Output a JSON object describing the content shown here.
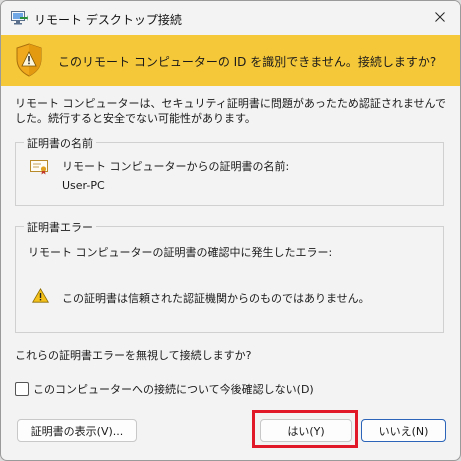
{
  "window": {
    "title": "リモート デスクトップ接続"
  },
  "banner": {
    "text": "このリモート コンピューターの ID を識別できません。接続しますか?"
  },
  "description": "リモート コンピューターは、セキュリティ証明書に問題があったため認証されませんでした。続行すると安全でない可能性があります。",
  "cert_name_group": {
    "label": "証明書の名前",
    "name_label": "リモート コンピューターからの証明書の名前:",
    "name_value": "User-PC"
  },
  "cert_error_group": {
    "label": "証明書エラー",
    "title": "リモート コンピューターの証明書の確認中に発生したエラー:",
    "message": "この証明書は信頼された認証機関からのものではありません。"
  },
  "question": "これらの証明書エラーを無視して接続しますか?",
  "checkbox": {
    "label": "このコンピューターへの接続について今後確認しない(D)",
    "checked": false
  },
  "buttons": {
    "view_cert": "証明書の表示(V)...",
    "yes": "はい(Y)",
    "no": "いいえ(N)"
  },
  "colors": {
    "banner": "#f5c83a",
    "highlight": "#e01828",
    "focus_border": "#2b64b8"
  },
  "icons": {
    "app": "remote-desktop-icon",
    "close": "close-icon",
    "banner": "warning-shield-icon",
    "cert": "certificate-icon",
    "warning": "warning-icon"
  }
}
